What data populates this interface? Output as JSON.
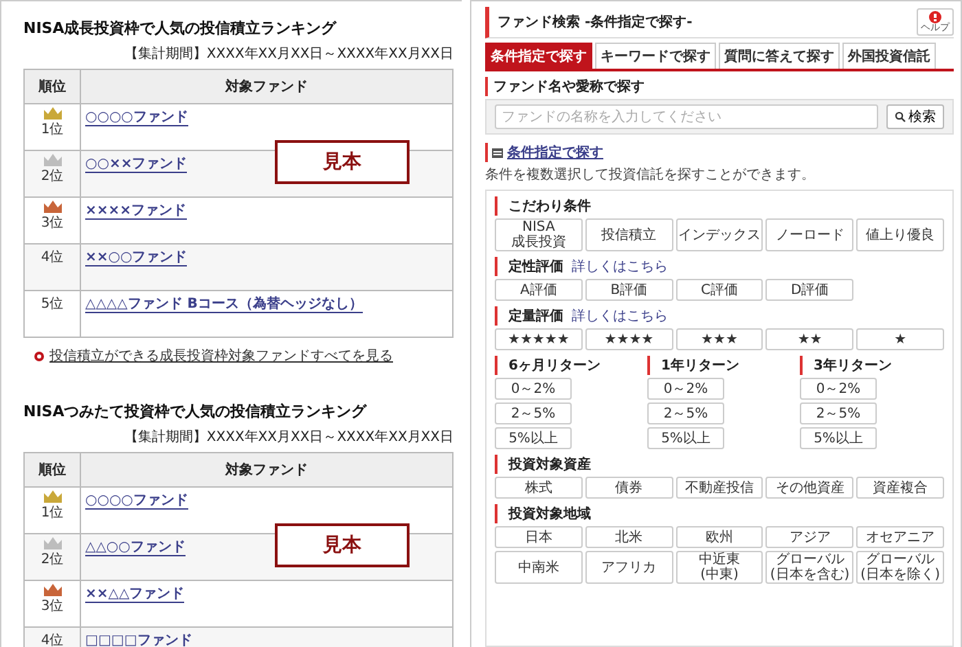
{
  "rankings": [
    {
      "title": "NISA成長投資枠で人気の投信積立ランキング",
      "period_label": "【集計期間】",
      "period": "XXXX年XX月XX日～XXXX年XX月XX日",
      "columns": [
        "順位",
        "対象ファンド"
      ],
      "stamp": "見本",
      "rows": [
        {
          "rank": "1位",
          "kind": "gold",
          "fund": "○○○○ファンド"
        },
        {
          "rank": "2位",
          "kind": "silver",
          "fund": "○○××ファンド"
        },
        {
          "rank": "3位",
          "kind": "bronze",
          "fund": "××××ファンド"
        },
        {
          "rank": "4位",
          "kind": "plain",
          "fund": "××○○ファンド"
        },
        {
          "rank": "5位",
          "kind": "plain",
          "fund": "△△△△ファンド Bコース（為替ヘッジなし）"
        }
      ],
      "more_link": "投信積立ができる成長投資枠対象ファンドすべてを見る"
    },
    {
      "title": "NISAつみたて投資枠で人気の投信積立ランキング",
      "period_label": "【集計期間】",
      "period": "XXXX年XX月XX日～XXXX年XX月XX日",
      "columns": [
        "順位",
        "対象ファンド"
      ],
      "stamp": "見本",
      "rows": [
        {
          "rank": "1位",
          "kind": "gold",
          "fund": "○○○○ファンド"
        },
        {
          "rank": "2位",
          "kind": "silver",
          "fund": "△△○○ファンド"
        },
        {
          "rank": "3位",
          "kind": "bronze",
          "fund": "××△△ファンド"
        },
        {
          "rank": "4位",
          "kind": "plain",
          "fund": "□□□□ファンド"
        }
      ]
    }
  ],
  "search": {
    "title": "ファンド検索 -条件指定で探す-",
    "help": "ヘルプ",
    "tabs": [
      {
        "label": "条件指定で探す",
        "selected": true
      },
      {
        "label": "キーワードで探す",
        "selected": false
      },
      {
        "label": "質問に答えて探す",
        "selected": false
      },
      {
        "label": "外国投資信託",
        "selected": false
      }
    ],
    "name_heading": "ファンド名や愛称で探す",
    "placeholder": "ファンドの名称を入力してください",
    "search_button": "検索",
    "condition_link": "条件指定で探す",
    "condition_desc": "条件を複数選択して投資信託を探すことができます。",
    "sections": [
      {
        "kind": "grid",
        "heading": "こだわり条件",
        "options": [
          "NISA\n成長投資",
          "投信積立",
          "インデックス",
          "ノーロード",
          "値上り優良"
        ]
      },
      {
        "kind": "grid",
        "heading": "定性評価",
        "detail_link": "詳しくはこちら",
        "options": [
          "A評価",
          "B評価",
          "C評価",
          "D評価"
        ]
      },
      {
        "kind": "grid",
        "heading": "定量評価",
        "detail_link": "詳しくはこちら",
        "options": [
          "★★★★★",
          "★★★★",
          "★★★",
          "★★",
          "★"
        ]
      },
      {
        "kind": "columns",
        "groups": [
          {
            "heading": "6ヶ月リターン",
            "options": [
              "0～2%",
              "2～5%",
              "5%以上"
            ]
          },
          {
            "heading": "1年リターン",
            "options": [
              "0～2%",
              "2～5%",
              "5%以上"
            ]
          },
          {
            "heading": "3年リターン",
            "options": [
              "0～2%",
              "2～5%",
              "5%以上"
            ]
          }
        ]
      },
      {
        "kind": "grid",
        "heading": "投資対象資産",
        "options": [
          "株式",
          "債券",
          "不動産投信",
          "その他資産",
          "資産複合"
        ]
      },
      {
        "kind": "grid",
        "heading": "投資対象地域",
        "options": [
          "日本",
          "北米",
          "欧州",
          "アジア",
          "オセアニア",
          "中南米",
          "アフリカ",
          "中近東\n(中東)",
          "グローバル\n(日本を含む)",
          "グローバル\n(日本を除く)"
        ]
      }
    ]
  }
}
